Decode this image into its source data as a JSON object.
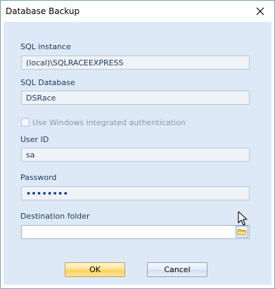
{
  "window": {
    "title": "Database Backup"
  },
  "form": {
    "sql_instance": {
      "label": "SQL instance",
      "value": "(local)\\SQLRACEEXPRESS"
    },
    "sql_database": {
      "label": "SQL Database",
      "value": "DSRace"
    },
    "windows_auth": {
      "label": "Use Windows integrated authentication",
      "checked": false,
      "enabled": false
    },
    "user_id": {
      "label": "User ID",
      "value": "sa"
    },
    "password": {
      "label": "Password",
      "value": "••••••••"
    },
    "destination_folder": {
      "label": "Destination folder",
      "value": ""
    }
  },
  "buttons": {
    "ok_label": "OK",
    "cancel_label": "Cancel"
  },
  "colors": {
    "client_bg": "#dde9f7",
    "label_text": "#1e395b",
    "ok_accent": "#ffd25c"
  },
  "icons": {
    "close": "close-icon",
    "browse": "folder-browse-icon",
    "cursor": "mouse-pointer-icon"
  }
}
